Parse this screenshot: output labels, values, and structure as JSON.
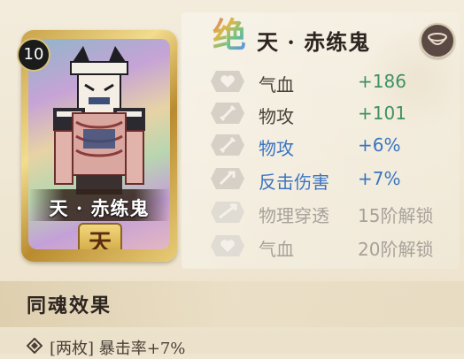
{
  "card": {
    "level": "10",
    "name": "天 · 赤练鬼",
    "slot_glyph": "天"
  },
  "header": {
    "rarity_glyph": "绝",
    "title": "天 · 赤练鬼"
  },
  "stats": [
    {
      "icon": "heart-icon",
      "label": "气血",
      "value": "+186",
      "color": "green"
    },
    {
      "icon": "sword-icon",
      "label": "物攻",
      "value": "+101",
      "color": "green"
    },
    {
      "icon": "sword-icon",
      "label": "物攻",
      "value": "+6%",
      "color": "blue"
    },
    {
      "icon": "counter-icon",
      "label": "反击伤害",
      "value": "+7%",
      "color": "blue"
    },
    {
      "icon": "pierce-icon",
      "label": "物理穿透",
      "value": "15阶解锁",
      "color": "gray"
    },
    {
      "icon": "heart-icon",
      "label": "气血",
      "value": "20阶解锁",
      "color": "gray"
    }
  ],
  "section": {
    "title": "同魂效果",
    "effect_text": "[两枚] 暴击率+7%"
  },
  "colors": {
    "green": "#3f9160",
    "blue": "#3a74c2",
    "gray": "#a8a19a",
    "text_dark": "#4a4038"
  }
}
